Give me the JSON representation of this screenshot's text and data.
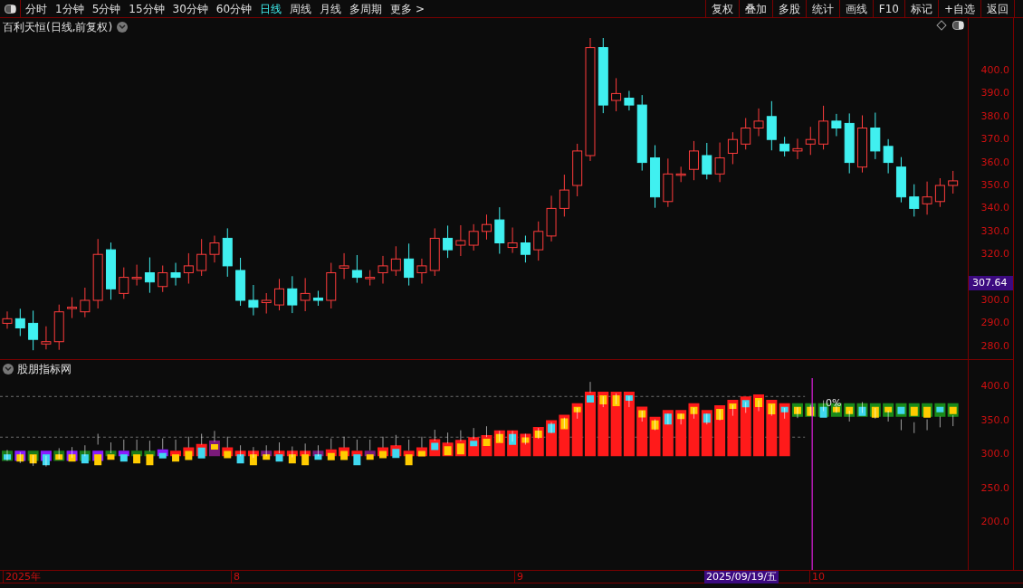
{
  "toolbar": {
    "periods": [
      {
        "label": "分时",
        "selected": false
      },
      {
        "label": "1分钟",
        "selected": false
      },
      {
        "label": "5分钟",
        "selected": false
      },
      {
        "label": "15分钟",
        "selected": false
      },
      {
        "label": "30分钟",
        "selected": false
      },
      {
        "label": "60分钟",
        "selected": false
      },
      {
        "label": "日线",
        "selected": true
      },
      {
        "label": "周线",
        "selected": false
      },
      {
        "label": "月线",
        "selected": false
      },
      {
        "label": "多周期",
        "selected": false
      }
    ],
    "more": "更多 >",
    "buttons": [
      "复权",
      "叠加",
      "多股",
      "统计",
      "画线",
      "F10",
      "标记",
      "+自选",
      "返回"
    ]
  },
  "price_chart": {
    "title": "百利天恒(日线,前复权)",
    "yticks": [
      "400.0",
      "390.0",
      "380.0",
      "370.0",
      "360.0",
      "350.0",
      "340.0",
      "330.0",
      "320.0",
      "300.0",
      "290.0",
      "280.0"
    ],
    "current_price": "307.64"
  },
  "indicator": {
    "title": "股朋指标网",
    "yticks": [
      "400.0",
      "350.0",
      "300.0",
      "250.0",
      "200.0"
    ],
    "marker": "0%"
  },
  "time_axis": {
    "labels": [
      "2025年",
      "8",
      "9",
      "10"
    ],
    "cursor_date": "2025/09/19/五"
  }
}
